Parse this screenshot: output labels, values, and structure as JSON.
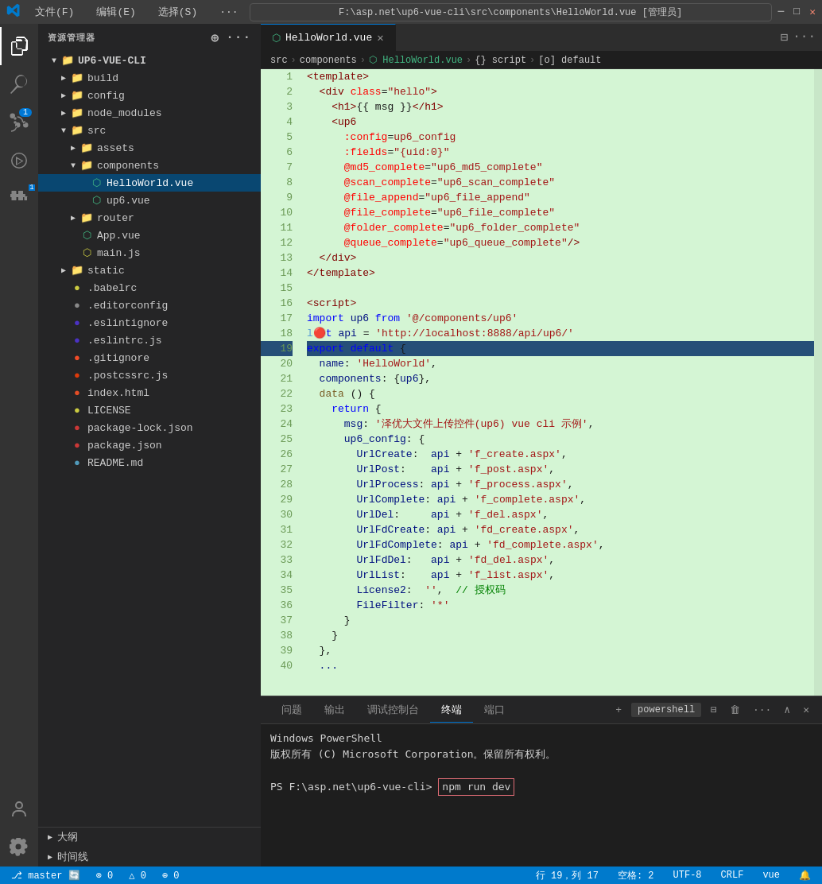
{
  "titlebar": {
    "path": "F:\\asp.net\\up6-vue-cli\\src\\components\\HelloWorld.vue [管理员]",
    "menus": [
      "文件(F)",
      "编辑(E)",
      "选择(S)",
      "···"
    ]
  },
  "sidebar": {
    "header": "资源管理器",
    "root": "UP6-VUE-CLI",
    "items": [
      {
        "id": "build",
        "label": "build",
        "type": "folder",
        "indent": 1,
        "expanded": false
      },
      {
        "id": "config",
        "label": "config",
        "type": "folder",
        "indent": 1,
        "expanded": false
      },
      {
        "id": "node_modules",
        "label": "node_modules",
        "type": "folder",
        "indent": 1,
        "expanded": false
      },
      {
        "id": "src",
        "label": "src",
        "type": "folder",
        "indent": 1,
        "expanded": true
      },
      {
        "id": "assets",
        "label": "assets",
        "type": "folder",
        "indent": 2,
        "expanded": false
      },
      {
        "id": "components",
        "label": "components",
        "type": "folder",
        "indent": 2,
        "expanded": true
      },
      {
        "id": "HelloWorld.vue",
        "label": "HelloWorld.vue",
        "type": "vue",
        "indent": 3,
        "active": true
      },
      {
        "id": "up6.vue",
        "label": "up6.vue",
        "type": "vue",
        "indent": 3
      },
      {
        "id": "router",
        "label": "router",
        "type": "folder",
        "indent": 2,
        "expanded": false
      },
      {
        "id": "App.vue",
        "label": "App.vue",
        "type": "vue",
        "indent": 2
      },
      {
        "id": "main.js",
        "label": "main.js",
        "type": "js",
        "indent": 2
      },
      {
        "id": "static",
        "label": "static",
        "type": "folder",
        "indent": 1,
        "expanded": false
      },
      {
        "id": ".babelrc",
        "label": ".babelrc",
        "type": "json",
        "indent": 1
      },
      {
        "id": ".editorconfig",
        "label": ".editorconfig",
        "type": "config",
        "indent": 1
      },
      {
        "id": ".eslintignore",
        "label": ".eslintignore",
        "type": "eslint",
        "indent": 1
      },
      {
        "id": ".eslintrc.js",
        "label": ".eslintrc.js",
        "type": "eslint-js",
        "indent": 1
      },
      {
        "id": ".gitignore",
        "label": ".gitignore",
        "type": "git",
        "indent": 1
      },
      {
        "id": ".postcssrc.js",
        "label": ".postcssrc.js",
        "type": "postcss",
        "indent": 1
      },
      {
        "id": "index.html",
        "label": "index.html",
        "type": "html",
        "indent": 1
      },
      {
        "id": "LICENSE",
        "label": "LICENSE",
        "type": "license",
        "indent": 1
      },
      {
        "id": "package-lock.json",
        "label": "package-lock.json",
        "type": "npm",
        "indent": 1
      },
      {
        "id": "package.json",
        "label": "package.json",
        "type": "npm",
        "indent": 1
      },
      {
        "id": "README.md",
        "label": "README.md",
        "type": "md",
        "indent": 1
      }
    ]
  },
  "tab": {
    "filename": "HelloWorld.vue",
    "icon": "vue"
  },
  "breadcrumb": {
    "items": [
      "src",
      "components",
      "HelloWorld.vue",
      "{} script",
      "[o] default"
    ]
  },
  "code": {
    "lines": [
      {
        "n": 1,
        "text": "  <template>"
      },
      {
        "n": 2,
        "text": "    <div class=\"hello\">"
      },
      {
        "n": 3,
        "text": "      <h1>{{ msg }}</h1>"
      },
      {
        "n": 4,
        "text": "      <up6"
      },
      {
        "n": 5,
        "text": "        :config=up6_config"
      },
      {
        "n": 6,
        "text": "        :fields=\"{uid:0}\""
      },
      {
        "n": 7,
        "text": "        @md5_complete=\"up6_md5_complete\""
      },
      {
        "n": 8,
        "text": "        @scan_complete=\"up6_scan_complete\""
      },
      {
        "n": 9,
        "text": "        @file_append=\"up6_file_append\""
      },
      {
        "n": 10,
        "text": "        @file_complete=\"up6_file_complete\""
      },
      {
        "n": 11,
        "text": "        @folder_complete=\"up6_folder_complete\""
      },
      {
        "n": 12,
        "text": "        @queue_complete=\"up6_queue_complete\"/>"
      },
      {
        "n": 13,
        "text": "    </div>"
      },
      {
        "n": 14,
        "text": "  </template>"
      },
      {
        "n": 15,
        "text": ""
      },
      {
        "n": 16,
        "text": "  <script>"
      },
      {
        "n": 17,
        "text": "  import up6 from '@/components/up6'"
      },
      {
        "n": 18,
        "text": "  let api = 'http://localhost:8888/api/up6/'"
      },
      {
        "n": 19,
        "text": "  export default {"
      },
      {
        "n": 20,
        "text": "    name: 'HelloWorld',"
      },
      {
        "n": 21,
        "text": "    components: {up6},"
      },
      {
        "n": 22,
        "text": "    data () {"
      },
      {
        "n": 23,
        "text": "      return {"
      },
      {
        "n": 24,
        "text": "        msg: '泽优大文件上传控件(up6) vue cli 示例',"
      },
      {
        "n": 25,
        "text": "        up6_config: {"
      },
      {
        "n": 26,
        "text": "          UrlCreate:  api + 'f_create.aspx',"
      },
      {
        "n": 27,
        "text": "          UrlPost:    api + 'f_post.aspx',"
      },
      {
        "n": 28,
        "text": "          UrlProcess: api + 'f_process.aspx',"
      },
      {
        "n": 29,
        "text": "          UrlComplete: api + 'f_complete.aspx',"
      },
      {
        "n": 30,
        "text": "          UrlDel:     api + 'f_del.aspx',"
      },
      {
        "n": 31,
        "text": "          UrlFdCreate: api + 'fd_create.aspx',"
      },
      {
        "n": 32,
        "text": "          UrlFdComplete: api + 'fd_complete.aspx',"
      },
      {
        "n": 33,
        "text": "          UrlFdDel:   api + 'fd_del.aspx',"
      },
      {
        "n": 34,
        "text": "          UrlList:    api + 'f_list.aspx',"
      },
      {
        "n": 35,
        "text": "          License2:  '',  // 授权码"
      },
      {
        "n": 36,
        "text": "          FileFilter: '*'"
      },
      {
        "n": 37,
        "text": "        }"
      },
      {
        "n": 38,
        "text": "      }"
      },
      {
        "n": 39,
        "text": "    },"
      },
      {
        "n": 40,
        "text": "    ..."
      }
    ]
  },
  "terminal": {
    "tabs": [
      "问题",
      "输出",
      "调试控制台",
      "终端",
      "端口"
    ],
    "active_tab": "终端",
    "powershell_label": "powershell",
    "content": [
      "Windows PowerShell",
      "版权所有 (C) Microsoft Corporation。保留所有权利。",
      "",
      "PS F:\\asp.net\\up6-vue-cli> npm run dev"
    ],
    "prompt": "PS F:\\asp.net\\up6-vue-cli> ",
    "command": "npm run dev"
  },
  "statusbar": {
    "branch": "master",
    "errors": "⊗ 0",
    "warnings": "△ 0",
    "info": "⊕ 0",
    "line": "行 19，列 17",
    "spaces": "空格: 2",
    "encoding": "UTF-8",
    "eol": "CRLF",
    "language": "vue"
  },
  "bottom_panels": [
    {
      "label": "大纲"
    },
    {
      "label": "时间线"
    }
  ]
}
